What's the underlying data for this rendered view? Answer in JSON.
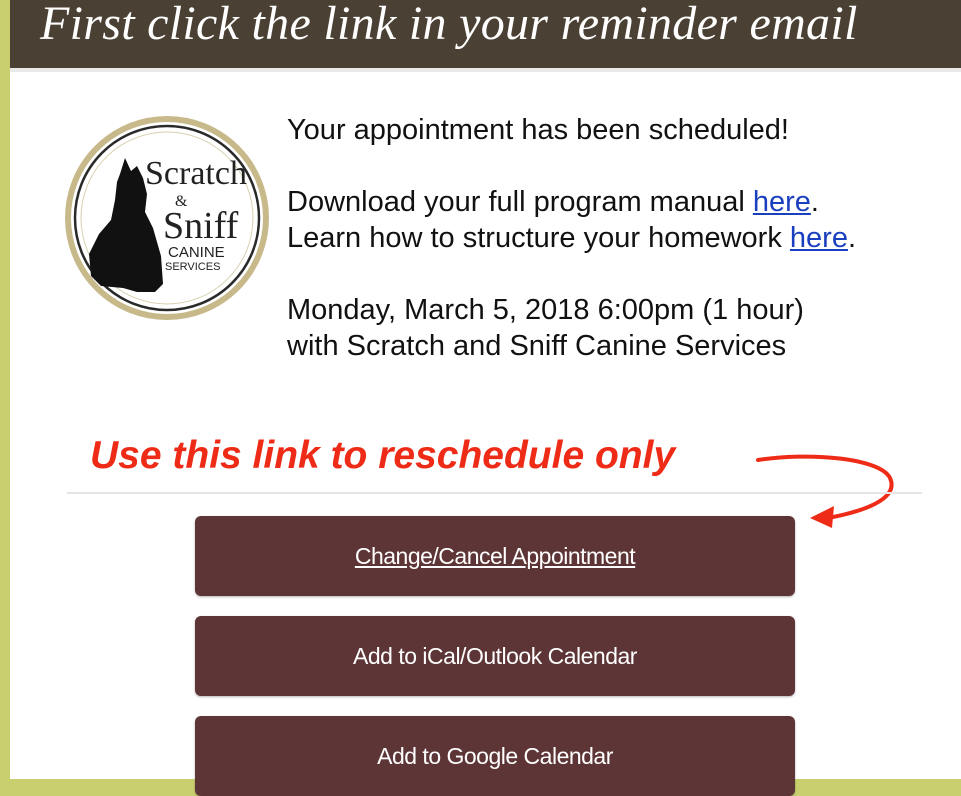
{
  "header": {
    "title": "First click the link in your reminder email"
  },
  "logo": {
    "line1": "Scratch",
    "amp": "&",
    "line2": "Sniff",
    "line3": "CANINE",
    "line4": "SERVICES"
  },
  "message": {
    "scheduled": "Your appointment has been scheduled!",
    "manual_prefix": "Download your full program manual ",
    "manual_link": "here",
    "manual_suffix": ".",
    "homework_prefix": "Learn how to structure your homework ",
    "homework_link": "here",
    "homework_suffix": ".",
    "datetime": "Monday, March 5, 2018 6:00pm (1 hour)",
    "with": "with Scratch and Sniff Canine Services"
  },
  "callout": {
    "text": "Use this link to reschedule only",
    "color": "#ee2b16"
  },
  "buttons": {
    "change_cancel": "Change/Cancel Appointment",
    "ical_outlook": "Add to iCal/Outlook Calendar",
    "google": "Add to Google Calendar",
    "color": "#5e3536"
  }
}
